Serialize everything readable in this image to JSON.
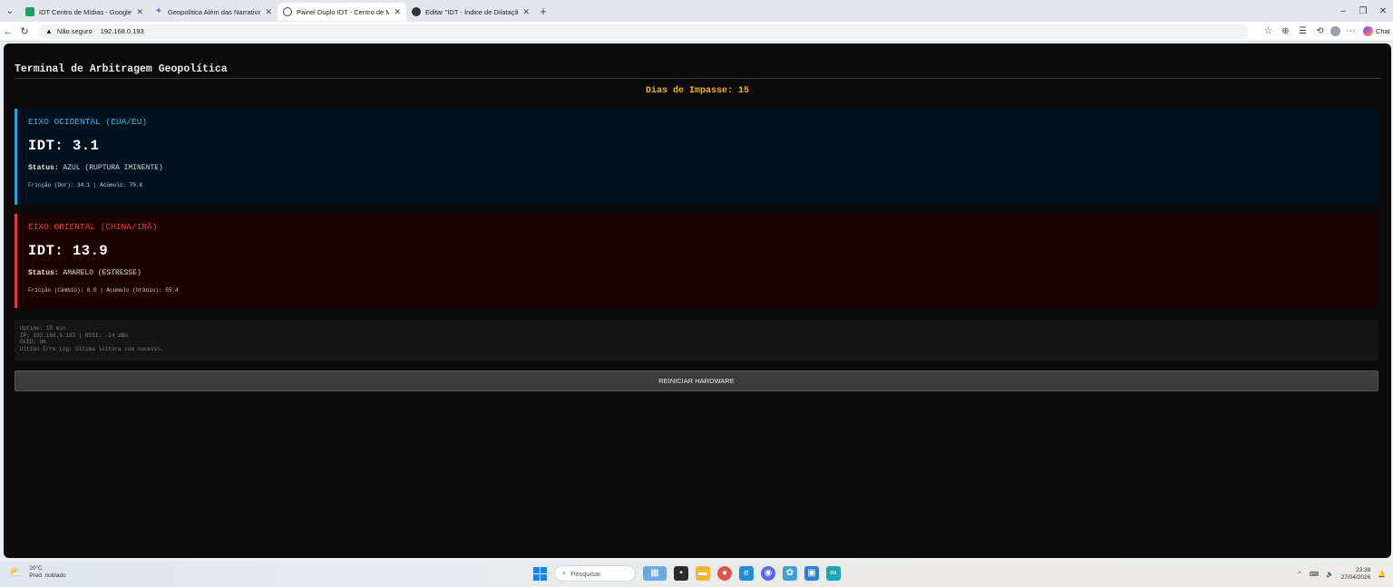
{
  "browser": {
    "tabs": [
      {
        "label": "IDT Centro de Mídias - Google Pla",
        "favicon": "sheets-icon"
      },
      {
        "label": "Geopolítica Além das Narrativas - ",
        "favicon": "gemini-icon"
      },
      {
        "label": "Painel Duplo IDT - Centro de Mídi",
        "favicon": "globe-icon",
        "active": true
      },
      {
        "label": "Editar \"IDT - Índice de Dilatação Te",
        "favicon": "wordpress-icon"
      }
    ],
    "security_label": "Não seguro",
    "url": "192.168.0.193",
    "chat_label": "Chat"
  },
  "page": {
    "title": "Terminal de Arbitragem Geopolítica",
    "impasse": "Dias de Impasse: 15"
  },
  "west": {
    "title": "EIXO OCIDENTAL (EUA/EU)",
    "idt": "IDT: 3.1",
    "status_label": "Status:",
    "status_value": "AZUL (RUPTURA IMINENTE)",
    "detail": "Fricção (Dor): 34.1 | Acúmulo: 70.8",
    "accent": "#24a7e3"
  },
  "east": {
    "title": "EIXO ORIENTAL (CHINA/IRÃ)",
    "idt": "IDT: 13.9",
    "status_label": "Status:",
    "status_value": "AMARELO (ESTRESSE)",
    "detail": "Fricção (Câmbio): 6.0 | Acúmulo (Urânio): 55.4",
    "accent": "#e33a3a"
  },
  "system": {
    "uptime": "Uptime: 18 min",
    "network": "IP: 192.168.0.193 | RSSI: -24 dBm",
    "oled": "OLED: OK",
    "log": "Último Erro Log: Última leitura com sucesso."
  },
  "reboot_label": "REINICIAR HARDWARE",
  "taskbar": {
    "temperature": "20°C",
    "weather": "Pred. nublado",
    "search_placeholder": "Pesquisar",
    "time": "23:38",
    "date": "27/04/2026"
  }
}
